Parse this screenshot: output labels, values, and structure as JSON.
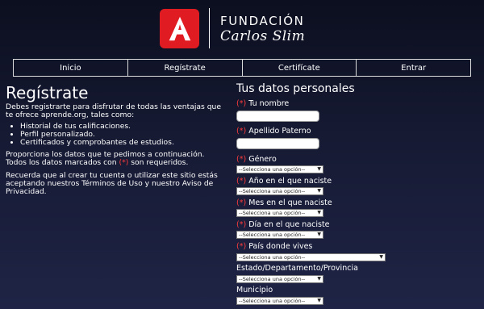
{
  "brand": {
    "logo_letter": "A",
    "line1": "FUNDACIÓN",
    "line2": "Carlos Slim",
    "color": "#e11b22"
  },
  "nav": {
    "items": [
      {
        "label": "Inicio"
      },
      {
        "label": "Regístrate"
      },
      {
        "label": "Certifícate"
      },
      {
        "label": "Entrar"
      }
    ]
  },
  "intro": {
    "title": "Regístrate",
    "p1": "Debes registrarte para disfrutar de todas las ventajas que te ofrece aprende.org, tales como:",
    "bullets": [
      "Historial de tus calificaciones.",
      "Perfil personalizado.",
      "Certificados y comprobantes de estudios."
    ],
    "p2_line1": "Proporciona los datos que te pedimos a continuación.",
    "p2_line2_prefix": "Todos los datos marcados con ",
    "p2_marker": "(*)",
    "p2_line2_suffix": " son requeridos.",
    "p3": "Recuerda que al crear tu cuenta o utilizar este sitio estás aceptando nuestros Términos de Uso y nuestro Aviso de Privacidad."
  },
  "form": {
    "title": "Tus datos personales",
    "required_marker": "(*)",
    "fields": {
      "nombre": {
        "label": "Tu nombre",
        "value": ""
      },
      "apellido": {
        "label": "Apellido Paterno",
        "value": ""
      },
      "genero": {
        "label": "Género",
        "selected": "--Selecciona una opción--"
      },
      "anio": {
        "label": "Año en el que naciste",
        "selected": "--Selecciona una opción--"
      },
      "mes": {
        "label": "Mes en el que naciste",
        "selected": "--Selecciona una opción--"
      },
      "dia": {
        "label": "Día en el que naciste",
        "selected": "--Selecciona una opción--"
      },
      "pais": {
        "label": "País donde vives",
        "selected": "--Selecciona una opción--"
      },
      "estado": {
        "label": "Estado/Departamento/Provincia",
        "selected": "--Selecciona una opción--"
      },
      "municipio": {
        "label": "Municipio",
        "selected": "--Selecciona una opción--"
      }
    }
  }
}
